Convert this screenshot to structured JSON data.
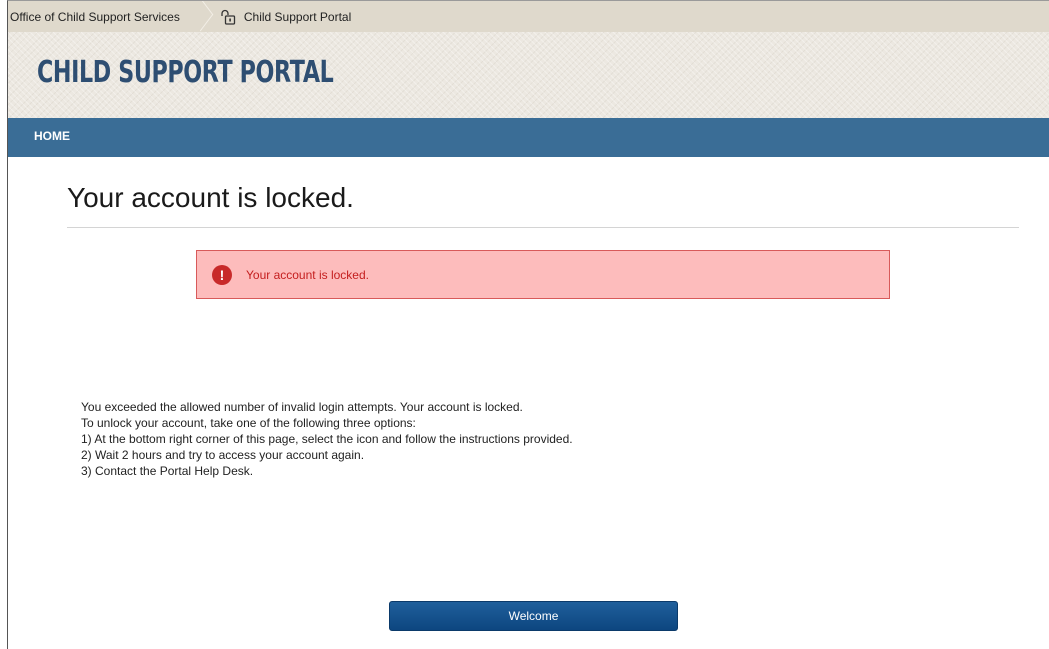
{
  "breadcrumb": {
    "items": [
      {
        "label": "Office of Child Support Services"
      },
      {
        "label": "Child Support Portal",
        "icon": "lock-icon"
      }
    ]
  },
  "header": {
    "title": "CHILD SUPPORT PORTAL"
  },
  "nav": {
    "home_label": "HOME"
  },
  "main": {
    "page_title": "Your account is locked.",
    "alert": {
      "icon": "exclamation-icon",
      "icon_glyph": "!",
      "message": "Your account is locked."
    },
    "instructions": [
      "You exceeded the allowed number of invalid login attempts. Your account is locked.",
      "To unlock your account, take one of the following three options:",
      "1) At the bottom right corner of this page, select the icon and follow the instructions provided.",
      "2) Wait 2 hours and try to access your account again.",
      "3) Contact the Portal Help Desk."
    ],
    "welcome_button_label": "Welcome"
  },
  "colors": {
    "nav_background": "#3a6d96",
    "title_color": "#2e4e72",
    "alert_background": "#fdbcbc",
    "alert_border": "#d85a5a",
    "alert_text": "#c41e1e",
    "button_background": "#0d4680"
  }
}
